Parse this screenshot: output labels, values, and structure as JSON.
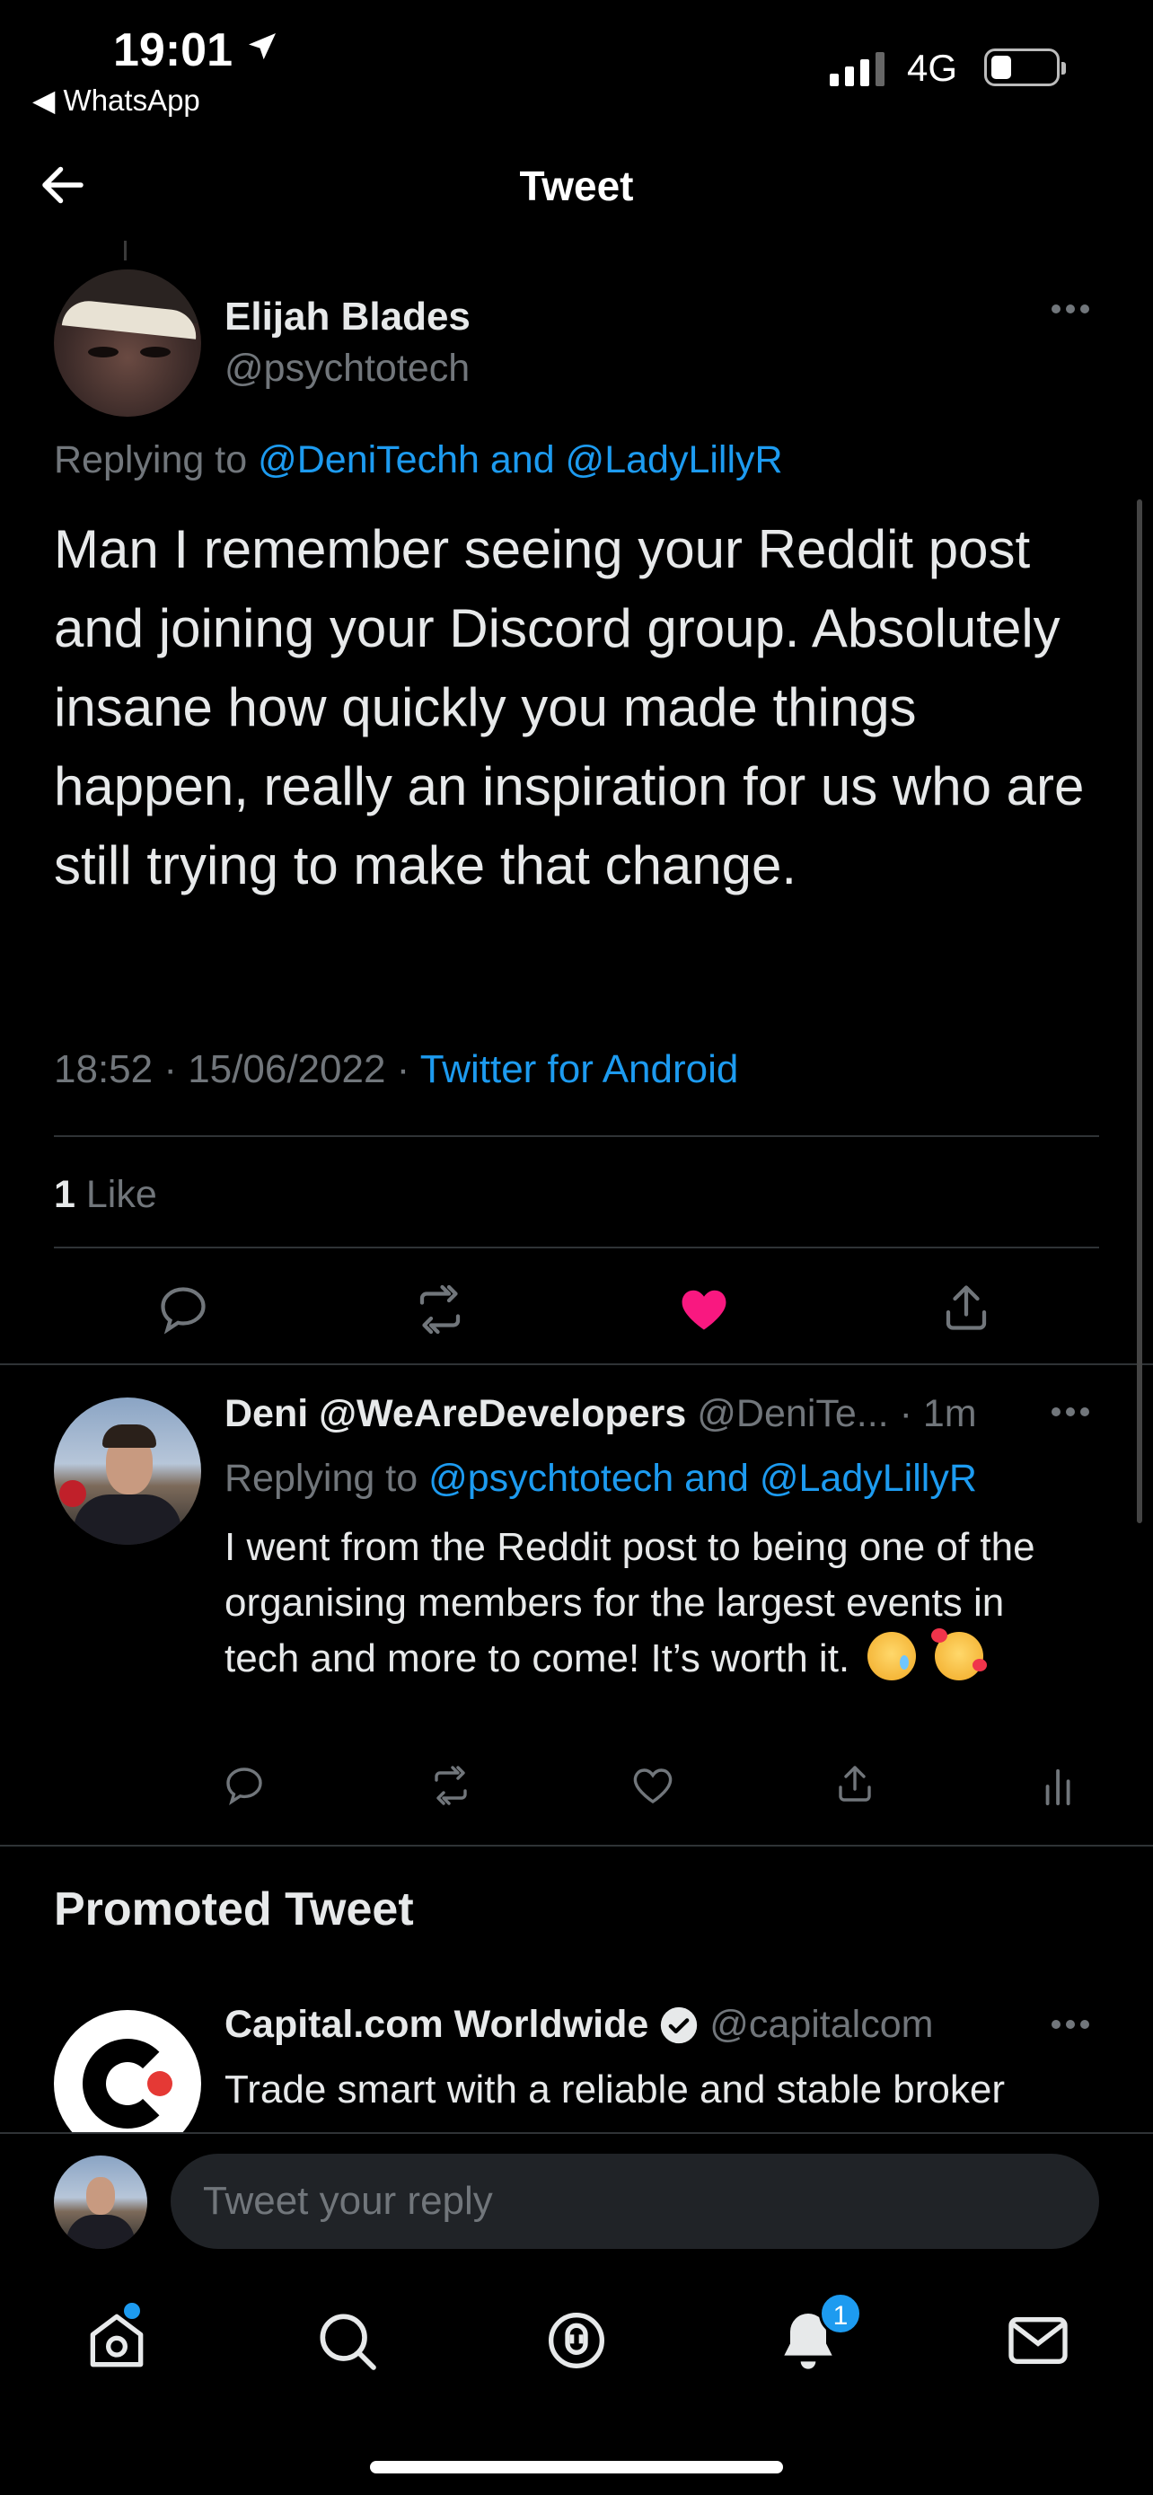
{
  "status_bar": {
    "time": "19:01",
    "back_app": "◀ WhatsApp",
    "network": "4G"
  },
  "header": {
    "title": "Tweet"
  },
  "main_tweet": {
    "name": "Elijah Blades",
    "handle": "@psychtotech",
    "replying_prefix": "Replying to",
    "replying_to": "@DeniTechh and @LadyLillyR",
    "text": "Man I remember seeing your Reddit post and joining your Discord group. Absolutely insane how quickly you made things happen, really an inspiration for us who are still trying to make that change.",
    "time": "18:52 · 15/06/2022 ·",
    "source": "Twitter for Android",
    "likes_count": "1",
    "likes_label": "Like",
    "liked": true
  },
  "reply_tweet": {
    "name": "Deni @WeAreDevelopers",
    "handle_time": "@DeniTe... · 1m",
    "replying_prefix": "Replying to",
    "replying_to": "@psychtotech and @LadyLillyR",
    "text": "I went from the Reddit post to being one of the organising members for the largest events in tech and more to come! It’s worth it."
  },
  "promoted": {
    "section_title": "Promoted Tweet",
    "name": "Capital.com Worldwide",
    "handle": "@capitalcom",
    "text": "Trade smart with a reliable and stable broker"
  },
  "reply_bar": {
    "placeholder": "Tweet your reply"
  },
  "tabbar": {
    "notifications_count": "1"
  },
  "colors": {
    "accent": "#1d9bf0",
    "like": "#f91880",
    "muted": "#71767b",
    "background": "#000000"
  }
}
